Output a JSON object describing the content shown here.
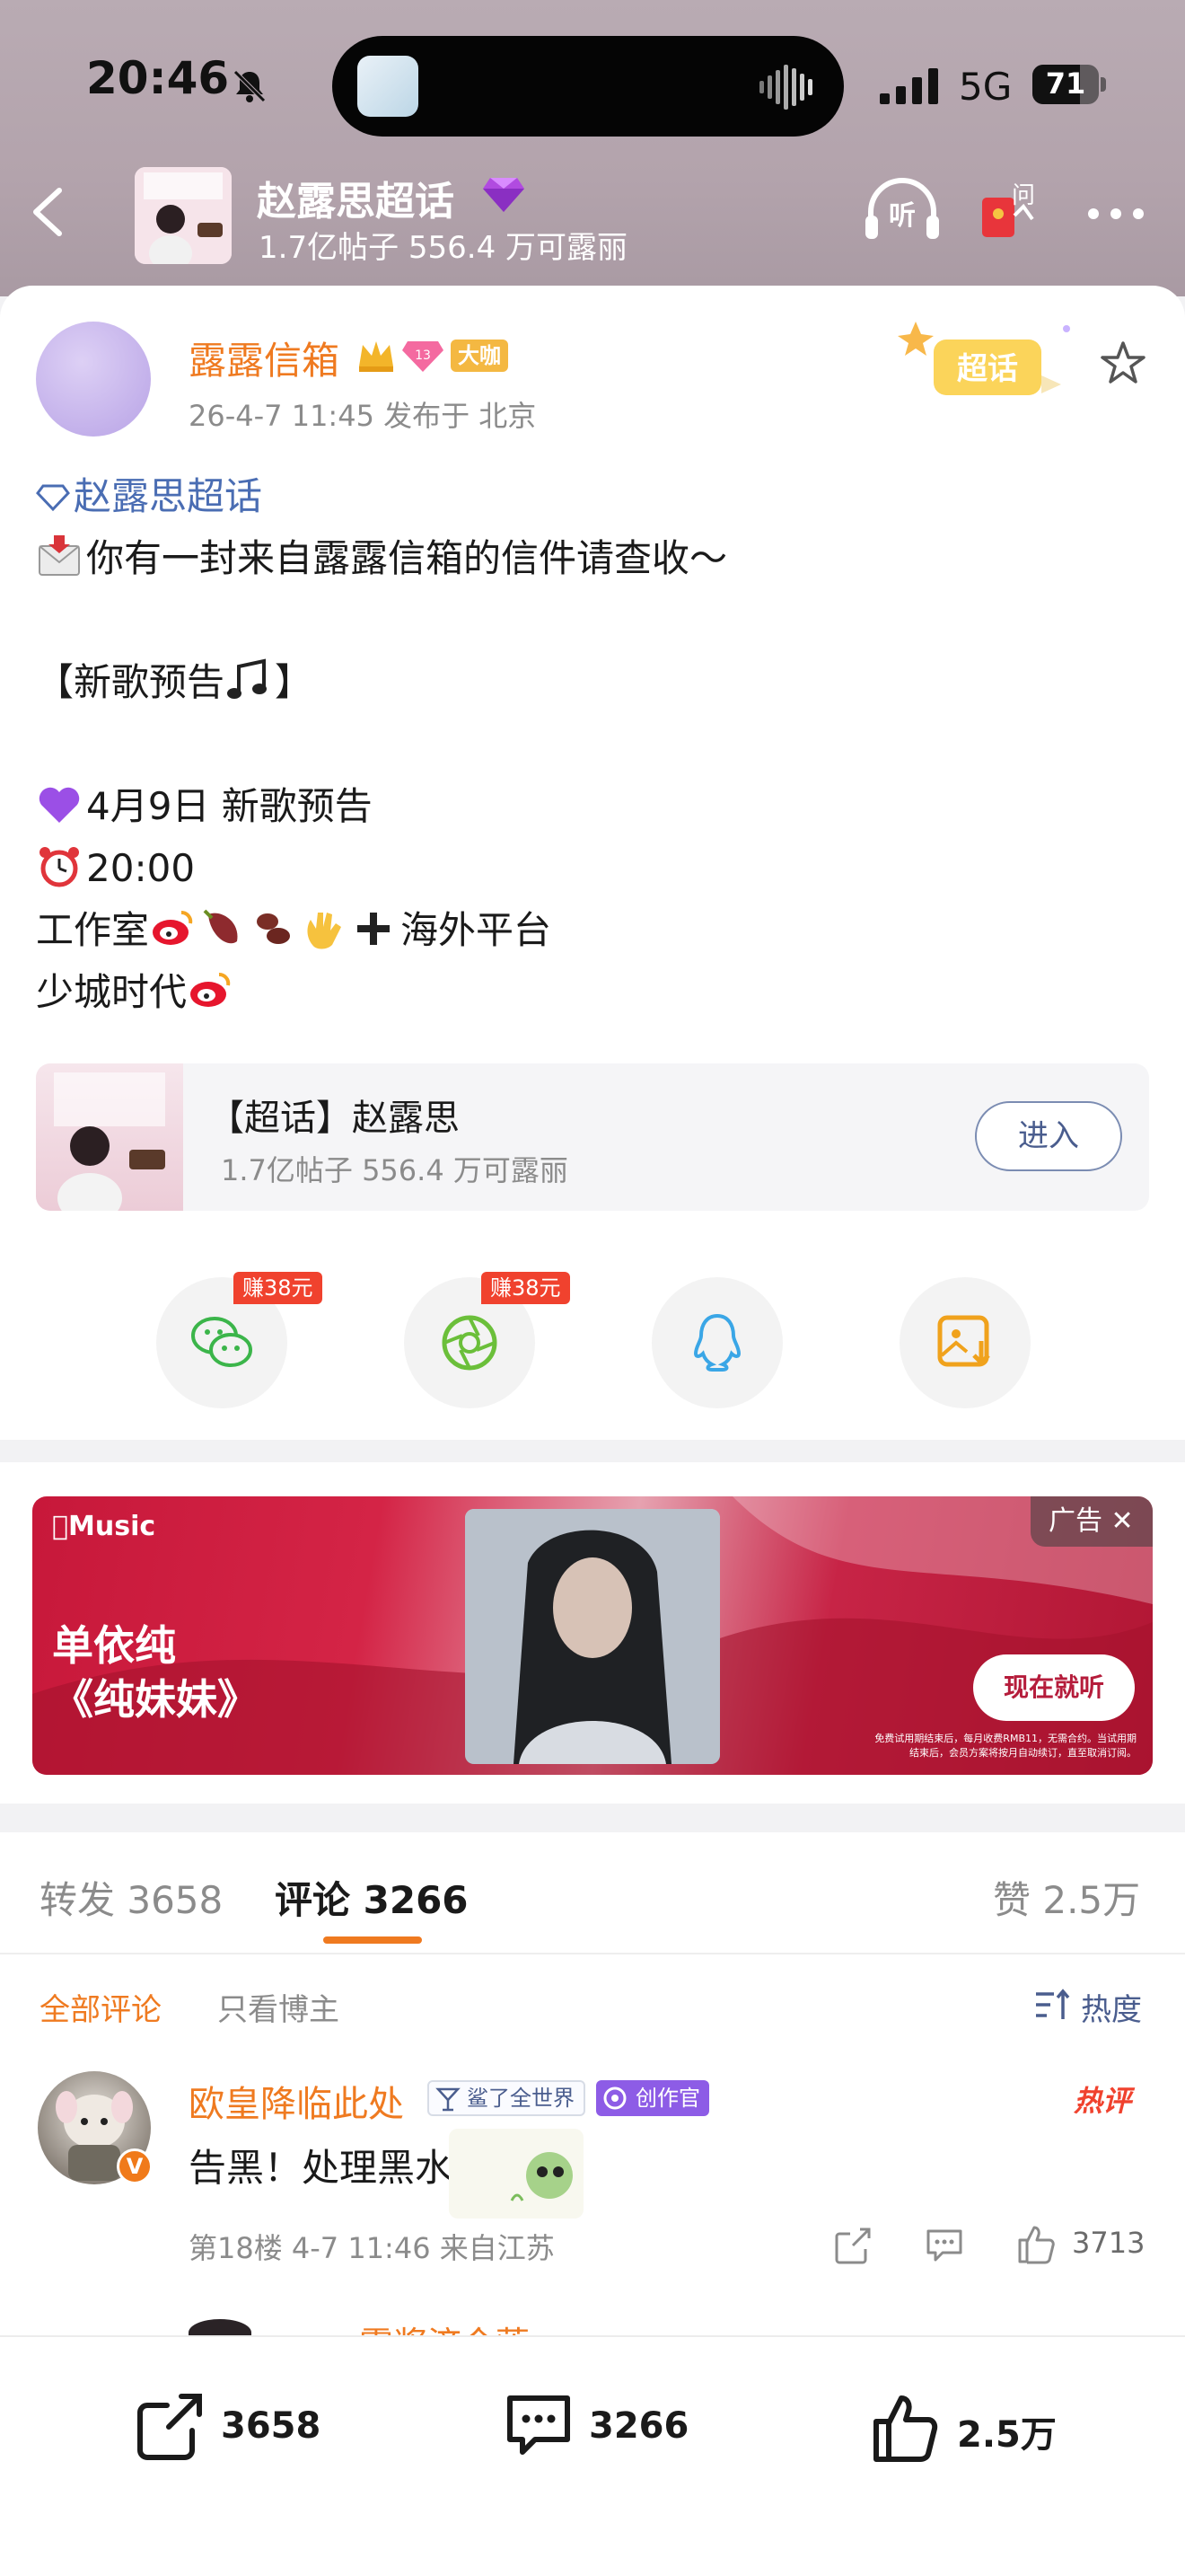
{
  "status_bar": {
    "time": "20:46",
    "network": "5G",
    "battery": "71",
    "battery_level": 0.71
  },
  "header": {
    "title": "赵露思超话",
    "subtitle": "1.7亿帖子  556.4 万可露丽",
    "icons": [
      "back-icon",
      "gem-icon",
      "listen-icon",
      "red-packet-ask-icon",
      "more-icon"
    ],
    "listen_label": "听",
    "ask_label": "问"
  },
  "post": {
    "author": "露露信箱",
    "author_badge": "大咖",
    "level_badge": "13",
    "meta": "26-4-7 11:45  发布于 北京",
    "sticker_text": "超话",
    "topic_link": "赵露思超话",
    "lines": [
      "你有一封来自露露信箱的信件请查收～",
      "",
      "【新歌预告",
      "",
      "4月9日 新歌预告",
      "20:00",
      "工作室",
      "少城时代"
    ],
    "line_suffix": {
      "title_close": "】",
      "platform": "海外平台"
    }
  },
  "topic_card": {
    "title": "【超话】赵露思",
    "subtitle": "1.7亿帖子  556.4 万可露丽",
    "enter_label": "进入"
  },
  "share": {
    "items": [
      {
        "icon": "wechat-icon",
        "badge": "赚38元"
      },
      {
        "icon": "moments-icon",
        "badge": "赚38元"
      },
      {
        "icon": "qq-icon",
        "badge": ""
      },
      {
        "icon": "save-image-icon",
        "badge": ""
      }
    ]
  },
  "ad": {
    "brand": "Music",
    "artist": "单依纯",
    "song": "《纯妹妹》",
    "cta": "现在就听",
    "tag": "广告",
    "fineprint": "免费试用期结束后，每月收费RMB11，无需合约。当试用期结束后，会员方案将按月自动续订，直至取消订阅。",
    "colors": {
      "primary": "#c7183a",
      "cta_text": "#b51c3b"
    }
  },
  "tabs": {
    "repost": "转发 3658",
    "comments": "评论 3266",
    "likes": "赞 2.5万"
  },
  "filters": {
    "all": "全部评论",
    "author_only": "只看博主",
    "sort": "热度"
  },
  "comment": {
    "name": "欧皇降临此处",
    "badge1": "鲨了全世界",
    "badge2": "创作官",
    "hot_tag": "热评",
    "verify": "V",
    "text": "告黑！处理黑水！",
    "meta": "第18楼  4-7 11:46  来自江苏",
    "likes": "3713",
    "next_name": "露浆济今莲"
  },
  "bottom_bar": {
    "repost": "3658",
    "comments": "3266",
    "likes": "2.5万"
  },
  "colors": {
    "accent": "#ef7a20",
    "link": "#4a6db3",
    "red": "#f0422e"
  }
}
